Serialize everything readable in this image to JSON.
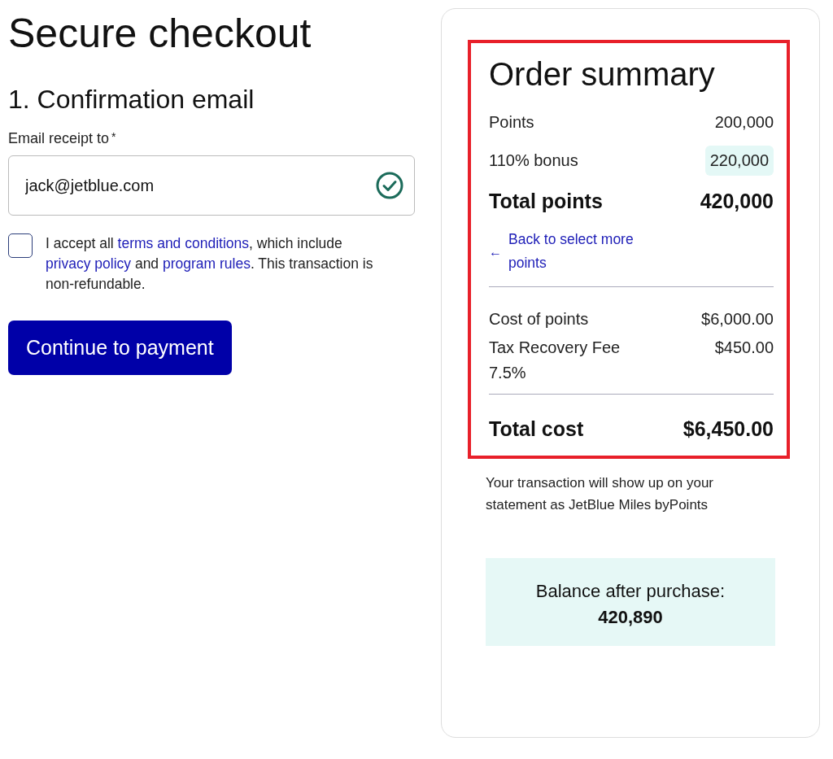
{
  "page_title": "Secure checkout",
  "section_title": "1. Confirmation email",
  "email": {
    "label": "Email receipt to",
    "required_mark": "*",
    "value": "jack@jetblue.com",
    "valid": true
  },
  "consent": {
    "checked": false,
    "parts": [
      {
        "kind": "text",
        "text": "I accept all "
      },
      {
        "kind": "link",
        "text": "terms and conditions"
      },
      {
        "kind": "text",
        "text": ", which include "
      },
      {
        "kind": "link",
        "text": "privacy policy"
      },
      {
        "kind": "text",
        "text": " and "
      },
      {
        "kind": "link",
        "text": "program rules"
      },
      {
        "kind": "text",
        "text": ". This transaction is non-refundable."
      }
    ]
  },
  "continue_button": "Continue to payment",
  "summary": {
    "title": "Order summary",
    "highlighted": true,
    "points_rows": [
      {
        "kind": "line",
        "label": "Points",
        "value": "200,000"
      },
      {
        "kind": "highlight",
        "label": "110% bonus",
        "value": "220,000"
      },
      {
        "kind": "total",
        "label": "Total points",
        "value": "420,000"
      }
    ],
    "back_link": {
      "arrow": "←",
      "text": "Back to select more points"
    },
    "cost_rows": [
      {
        "kind": "line",
        "label": "Cost of points",
        "value": "$6,000.00"
      },
      {
        "kind": "line",
        "label": "Tax Recovery Fee",
        "sublabel": "7.5%",
        "value": "$450.00"
      }
    ],
    "total_row": {
      "kind": "total",
      "label": "Total cost",
      "value": "$6,450.00"
    }
  },
  "statement_note": "Your transaction will show up on your statement as JetBlue Miles byPoints",
  "balance": {
    "label": "Balance after purchase:",
    "value": "420,890"
  }
}
